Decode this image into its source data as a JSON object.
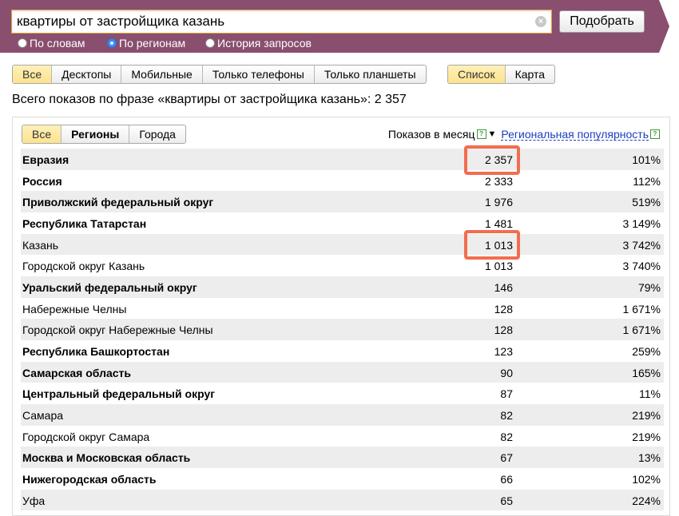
{
  "search": {
    "query": "квартиры от застройщика казань",
    "clear_symbol": "×",
    "submit_label": "Подобрать",
    "modes": [
      {
        "label": "По словам",
        "selected": false
      },
      {
        "label": "По регионам",
        "selected": true
      },
      {
        "label": "История запросов",
        "selected": false
      }
    ]
  },
  "device_filter": {
    "items": [
      "Все",
      "Десктопы",
      "Мобильные",
      "Только телефоны",
      "Только планшеты"
    ],
    "active": "Все"
  },
  "view_toggle": {
    "items": [
      "Список",
      "Карта"
    ],
    "active": "Список"
  },
  "summary": "Всего показов по фразе «квартиры от застройщика казань»: 2 357",
  "region_filter": {
    "items": [
      "Все",
      "Регионы",
      "Города"
    ],
    "active": "Все"
  },
  "table": {
    "impressions_header": "Показов в месяц",
    "popularity_header": "Региональная популярность",
    "help_symbol": "?",
    "sort_symbol": "▼",
    "rows": [
      {
        "name": "Евразия",
        "count": "2 357",
        "pct": "101%",
        "bold": true
      },
      {
        "name": "Россия",
        "count": "2 333",
        "pct": "112%",
        "bold": true
      },
      {
        "name": "Приволжский федеральный округ",
        "count": "1 976",
        "pct": "519%",
        "bold": true
      },
      {
        "name": "Республика Татарстан",
        "count": "1 481",
        "pct": "3 149%",
        "bold": true
      },
      {
        "name": "Казань",
        "count": "1 013",
        "pct": "3 742%",
        "bold": false
      },
      {
        "name": "Городской округ Казань",
        "count": "1 013",
        "pct": "3 740%",
        "bold": false
      },
      {
        "name": "Уральский федеральный округ",
        "count": "146",
        "pct": "79%",
        "bold": true
      },
      {
        "name": "Набережные Челны",
        "count": "128",
        "pct": "1 671%",
        "bold": false
      },
      {
        "name": "Городской округ Набережные Челны",
        "count": "128",
        "pct": "1 671%",
        "bold": false
      },
      {
        "name": "Республика Башкортостан",
        "count": "123",
        "pct": "259%",
        "bold": true
      },
      {
        "name": "Самарская область",
        "count": "90",
        "pct": "165%",
        "bold": true
      },
      {
        "name": "Центральный федеральный округ",
        "count": "87",
        "pct": "11%",
        "bold": true
      },
      {
        "name": "Самара",
        "count": "82",
        "pct": "219%",
        "bold": false
      },
      {
        "name": "Городской округ Самара",
        "count": "82",
        "pct": "219%",
        "bold": false
      },
      {
        "name": "Москва и Московская область",
        "count": "67",
        "pct": "13%",
        "bold": true
      },
      {
        "name": "Нижегородская область",
        "count": "66",
        "pct": "102%",
        "bold": true
      },
      {
        "name": "Уфа",
        "count": "65",
        "pct": "224%",
        "bold": false
      }
    ]
  },
  "colors": {
    "band": "#8a4e6f",
    "active_tab": "#fde28e",
    "highlight": "#f26d4f",
    "link": "#1a3dc1"
  }
}
